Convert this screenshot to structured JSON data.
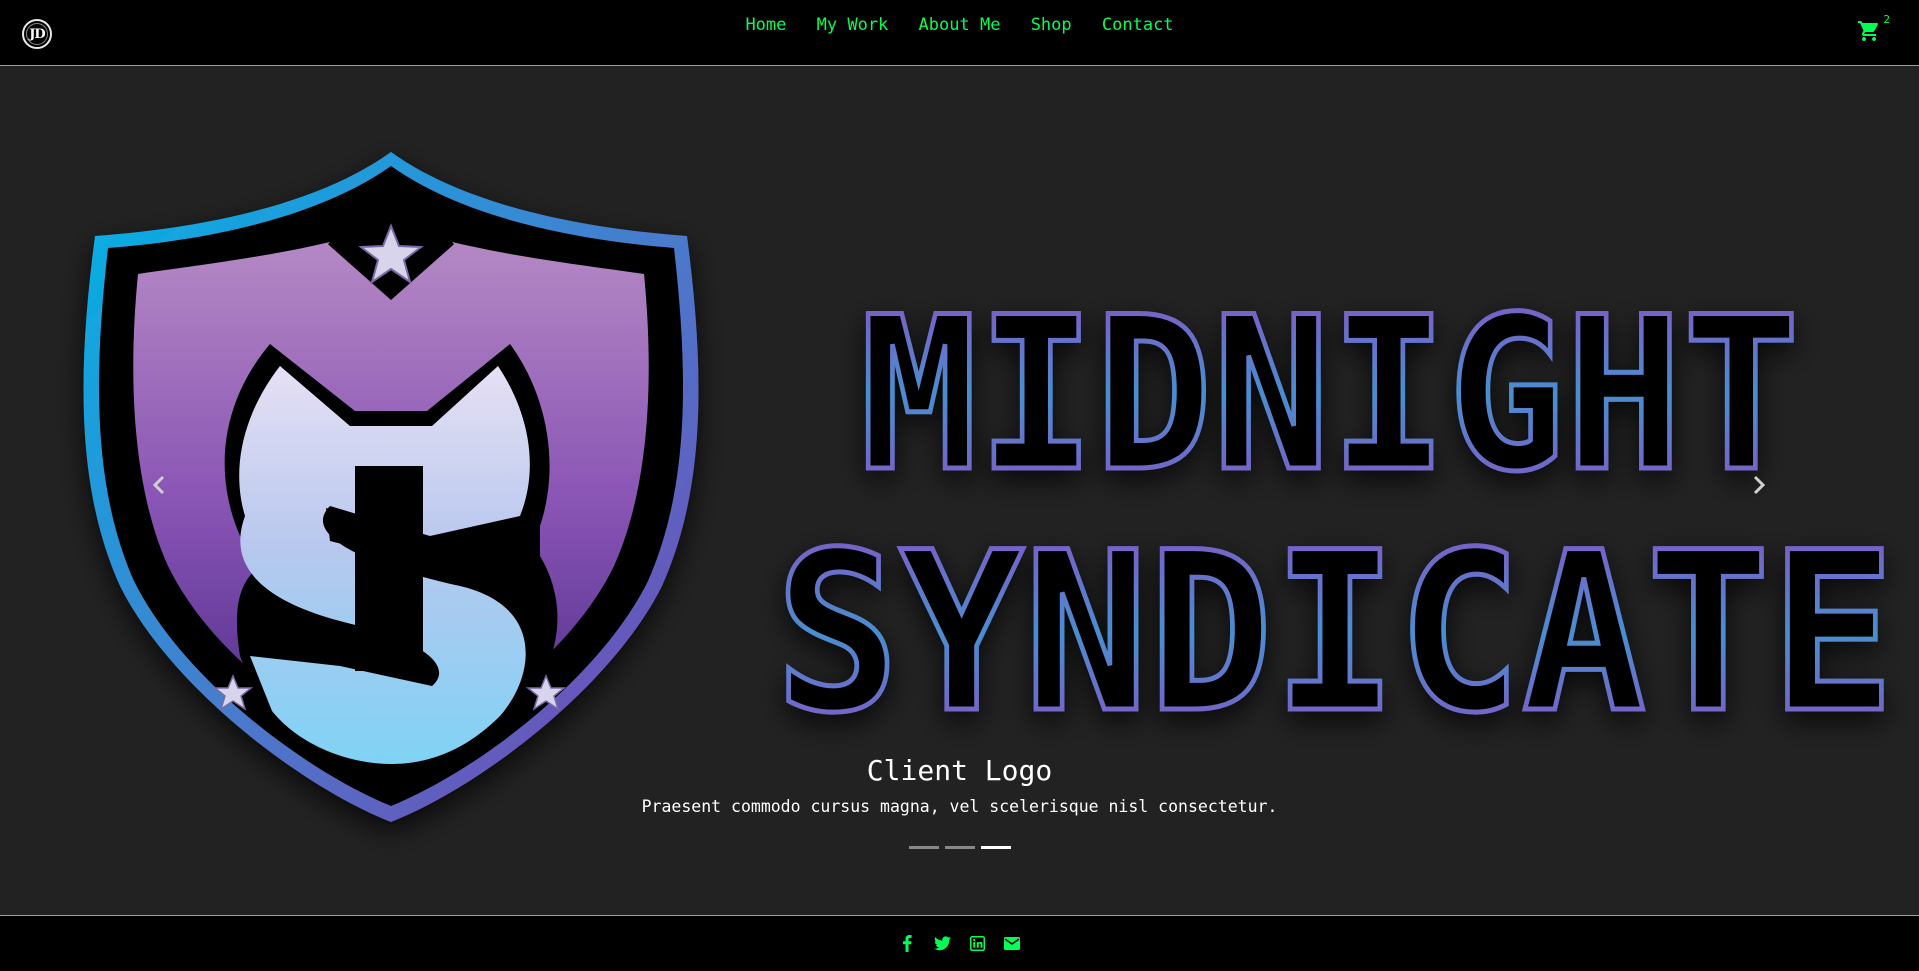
{
  "brand": {
    "logo_text": "JD"
  },
  "nav": {
    "links": [
      "Home",
      "My Work",
      "About Me",
      "Shop",
      "Contact"
    ]
  },
  "cart": {
    "icon": "cart-icon",
    "count": "2"
  },
  "carousel": {
    "slide": {
      "logo_text_line1": "MIDNIGHT",
      "logo_text_line2": "SYNDICATE",
      "caption_title": "Client Logo",
      "caption_text": "Praesent commodo cursus magna, vel scelerisque nisl consectetur."
    },
    "indicators": {
      "count": 3,
      "active_index": 2
    },
    "prev_icon": "chevron-left-icon",
    "next_icon": "chevron-right-icon"
  },
  "footer": {
    "social": [
      "facebook-icon",
      "twitter-icon",
      "linkedin-icon",
      "email-icon"
    ]
  },
  "colors": {
    "accent": "#00ff55",
    "background": "#222222",
    "bar": "#000000",
    "logo_cyan": "#00b4e6",
    "logo_purple": "#7b3fb0"
  }
}
